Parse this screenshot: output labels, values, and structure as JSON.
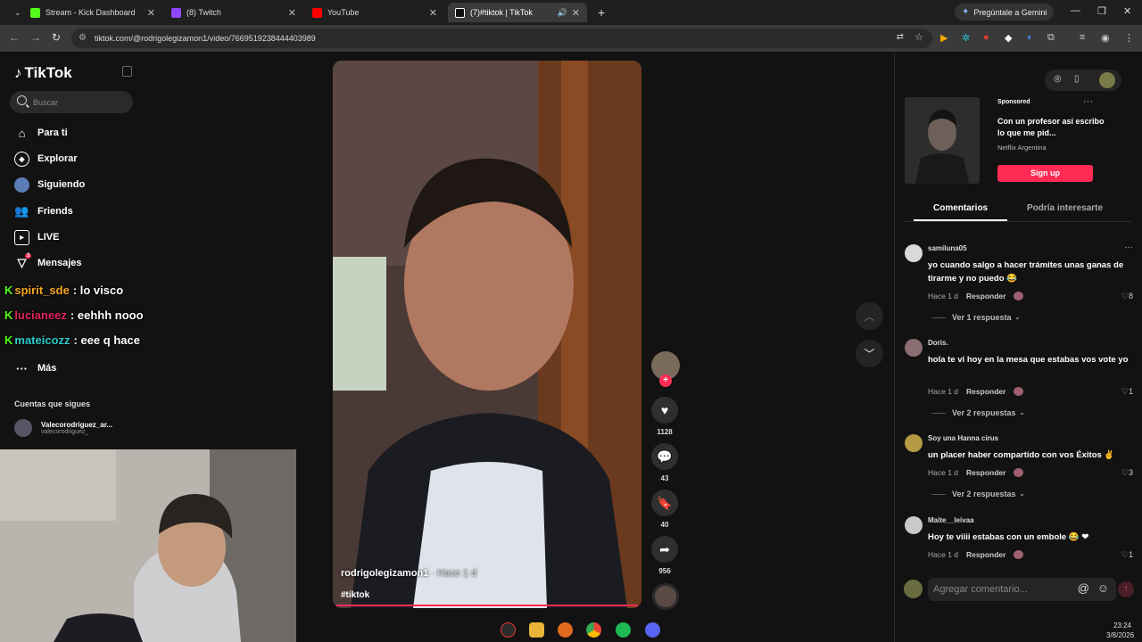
{
  "browser": {
    "tabs": [
      {
        "title": "Stream - Kick Dashboard",
        "color": "#53fc18"
      },
      {
        "title": "(8) Twitch",
        "color": "#9146ff"
      },
      {
        "title": "YouTube",
        "color": "#ff0000"
      },
      {
        "title": "(7)#tiktok | TikTok",
        "color": "#ffffff"
      }
    ],
    "gemini_label": "Pregúntale a Gemini",
    "url": "tiktok.com/@rodrigolegizamon1/video/7669519238444403989"
  },
  "sidebar": {
    "logo": "TikTok",
    "search_placeholder": "Buscar",
    "nav": [
      {
        "label": "Para ti",
        "icon": "home-icon"
      },
      {
        "label": "Explorar",
        "icon": "compass-icon"
      },
      {
        "label": "Siguiendo",
        "icon": "following-icon"
      },
      {
        "label": "Friends",
        "icon": "friends-icon"
      },
      {
        "label": "LIVE",
        "icon": "live-icon"
      },
      {
        "label": "Mensajes",
        "icon": "send-icon",
        "badge": "3"
      }
    ],
    "more_label": "Más",
    "following_title": "Cuentas que sigues",
    "following_account": {
      "name": "Valecorodriguez_ar...",
      "handle": "valecorodriguez_"
    }
  },
  "chat_overlay": [
    {
      "user": "spirit_sde",
      "user_color": "#f5a623",
      "message": ": lo visco"
    },
    {
      "user": "lucianeez",
      "user_color": "#e0245e",
      "message": ": eehhh nooo"
    },
    {
      "user": "mateicozz",
      "user_color": "#2ecbcb",
      "message": ": eee q hace"
    }
  ],
  "video": {
    "author": "rodrigolegizamon1",
    "time_sep": " · Hace 1 d",
    "hashtag": "#tiktok",
    "progress": 1.0
  },
  "actions": [
    {
      "icon": "heart-icon",
      "count": "1128"
    },
    {
      "icon": "comment-icon",
      "count": "43"
    },
    {
      "icon": "bookmark-icon",
      "count": "40"
    },
    {
      "icon": "share-icon",
      "count": "956"
    }
  ],
  "ad": {
    "sponsored": "Sponsored",
    "title": "Con un profesor así escribo lo que me pid...",
    "brand": "Netflix Argentina",
    "cta": "Sign up"
  },
  "panel_tabs": {
    "comments": "Comentarios",
    "suggested": "Podría interesarte"
  },
  "comments": [
    {
      "user": "samiluna05",
      "text": "yo cuando salgo a hacer trámites unas ganas de tirarme y no puedo 😂",
      "time": "Hace 1 d",
      "reply": "Responder",
      "likes": "8",
      "view_replies": "Ver 1 respuesta",
      "avatar_color": "#d9d9d9"
    },
    {
      "user": "Doris.",
      "text": "hola te vi hoy en la mesa que estabas vos vote yo",
      "time": "Hace 1 d",
      "reply": "Responder",
      "likes": "1",
      "view_replies": "Ver 2 respuestas",
      "avatar_color": "#8a6e72"
    },
    {
      "user": "Soy una Hanna cirus",
      "text": "un placer haber compartido con vos Éxitos ✌",
      "time": "Hace 1 d",
      "reply": "Responder",
      "likes": "3",
      "view_replies": "Ver 2 respuestas",
      "avatar_color": "#b59a43"
    },
    {
      "user": "Maite__leivaa",
      "text": "Hoy te viiii estabas con un embole 😂 ❤",
      "time": "Hace 1 d",
      "reply": "Responder",
      "likes": "1",
      "view_replies": "",
      "avatar_color": "#c9c9c9"
    }
  ],
  "comment_placeholder": "Agregar comentario...",
  "clock": {
    "time": "23:24",
    "date": "3/8/2026"
  }
}
